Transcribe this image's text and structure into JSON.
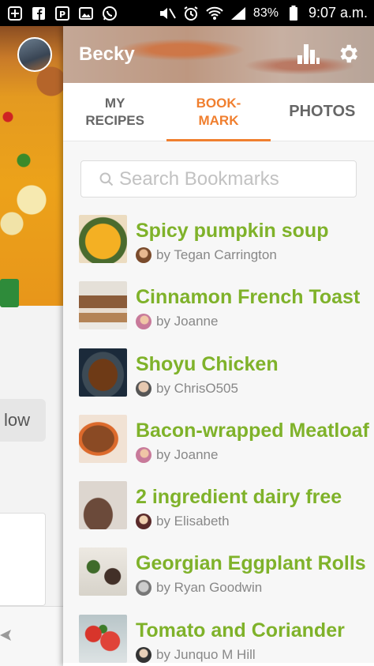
{
  "status_bar": {
    "battery_percent": "83%",
    "time": "9:07 a.m.",
    "icons": [
      "add-icon",
      "facebook-icon",
      "messenger-icon",
      "gallery-icon",
      "whatsapp-icon",
      "mute-icon",
      "alarm-icon",
      "wifi-icon",
      "signal-icon",
      "battery-icon"
    ]
  },
  "background_page": {
    "button_partial_label": "low"
  },
  "drawer": {
    "user_name": "Becky",
    "tabs": [
      {
        "label": "MY\nRECIPES",
        "active": false
      },
      {
        "label": "BOOK-\nMARK",
        "active": true
      },
      {
        "label": "PHOTOS",
        "active": false
      }
    ],
    "search": {
      "placeholder": "Search Bookmarks",
      "value": ""
    },
    "bookmarks": [
      {
        "title": "Spicy pumpkin soup",
        "author": "by Tegan Carrington"
      },
      {
        "title": "Cinnamon French Toast",
        "author": "by Joanne"
      },
      {
        "title": "Shoyu Chicken",
        "author": "by ChrisO505"
      },
      {
        "title": "Bacon-wrapped Meatloaf",
        "author": "by Joanne"
      },
      {
        "title": "2 ingredient dairy free",
        "author": "by Elisabeth"
      },
      {
        "title": "Georgian Eggplant Rolls",
        "author": "by Ryan Goodwin"
      },
      {
        "title": "Tomato and Coriander",
        "author": "by Junquo M Hill"
      }
    ]
  },
  "colors": {
    "accent_orange": "#f07f2f",
    "title_green": "#7fb22a"
  }
}
